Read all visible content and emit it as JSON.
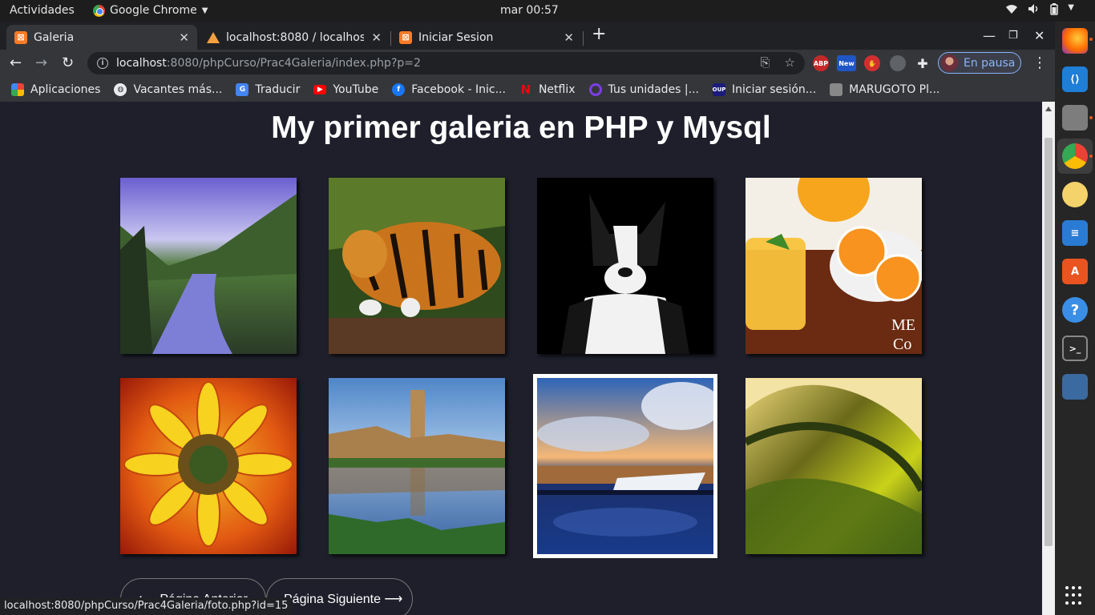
{
  "system_bar": {
    "activities": "Actividades",
    "app_name": "Google Chrome",
    "clock": "mar 00:57"
  },
  "tabs": [
    {
      "label": "Galeria",
      "active": true,
      "favicon": "xampp-icon"
    },
    {
      "label": "localhost:8080 / localhost",
      "active": false,
      "favicon": "phpmyadmin-icon"
    },
    {
      "label": "Iniciar Sesion",
      "active": false,
      "favicon": "xampp-icon"
    }
  ],
  "address_bar": {
    "host": "localhost",
    "path": ":8080/phpCurso/Prac4Galeria/index.php?p=2"
  },
  "profile": {
    "label": "En pausa"
  },
  "extensions": [
    "ABP",
    "New"
  ],
  "bookmarks": [
    {
      "label": "Aplicaciones",
      "icon": "apps-grid-icon",
      "color": "#4285f4"
    },
    {
      "label": "Vacantes más...",
      "icon": "globe-icon",
      "color": "#e8eaed"
    },
    {
      "label": "Traducir",
      "icon": "translate-icon",
      "color": "#8ab4f8"
    },
    {
      "label": "YouTube",
      "icon": "youtube-icon",
      "color": "#ff0000"
    },
    {
      "label": "Facebook - Inic...",
      "icon": "facebook-icon",
      "color": "#1877f2"
    },
    {
      "label": "Netflix",
      "icon": "netflix-icon",
      "color": "#e50914"
    },
    {
      "label": "Tus unidades |...",
      "icon": "unit-icon",
      "color": "#7b3fe4"
    },
    {
      "label": "Iniciar sesión...",
      "icon": "oup-icon",
      "color": "#1b1b7a"
    },
    {
      "label": "MARUGOTO Pl...",
      "icon": "marugoto-icon",
      "color": "#888888"
    }
  ],
  "page": {
    "title": "My primer galeria en PHP y Mysql",
    "photos": [
      {
        "name": "river-valley-photo"
      },
      {
        "name": "tiger-photo"
      },
      {
        "name": "dog-photo"
      },
      {
        "name": "orange-juice-photo"
      },
      {
        "name": "sunflower-painting-photo"
      },
      {
        "name": "ruins-reflection-photo"
      },
      {
        "name": "marina-sunset-photo",
        "hovered": true
      },
      {
        "name": "green-wave-photo"
      }
    ],
    "prev_button": "⟵  Página Anterior",
    "next_button": "Página Siguiente ⟶"
  },
  "status_bar": {
    "url": "localhost:8080/phpCurso/Prac4Galeria/foto.php?id=15"
  },
  "dock": {
    "apps": [
      "firefox-icon",
      "vscode-icon",
      "files-icon",
      "chrome-icon",
      "rhythmbox-icon",
      "writer-icon",
      "software-center-icon",
      "help-icon",
      "terminal-icon",
      "mysql-workbench-icon"
    ]
  }
}
